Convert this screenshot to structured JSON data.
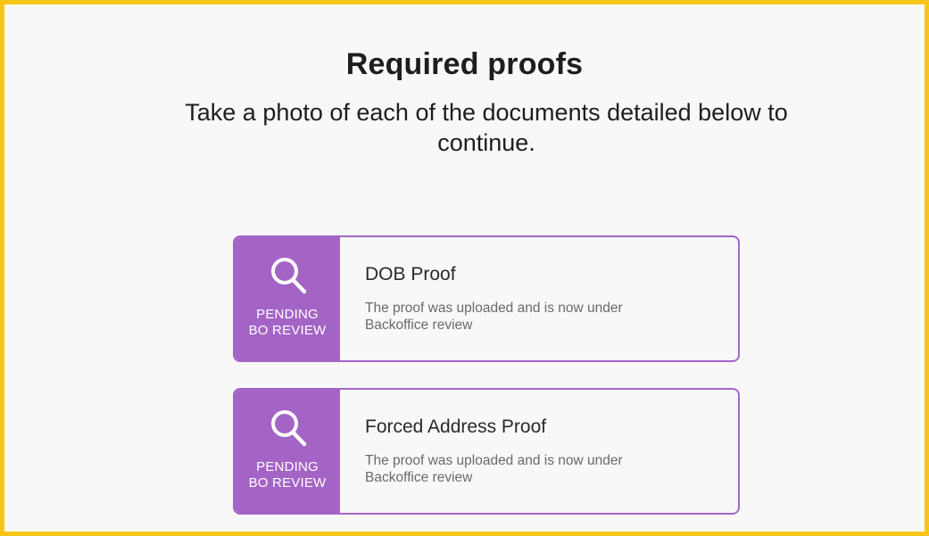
{
  "header": {
    "title": "Required proofs",
    "subtitle": "Take a photo of each of the documents detailed below to continue."
  },
  "proofs": [
    {
      "name": "DOB Proof",
      "status_line1": "PENDING",
      "status_line2": "BO REVIEW",
      "status_icon": "search-icon",
      "description": "The proof was uploaded and is now under Backoffice review"
    },
    {
      "name": "Forced Address Proof",
      "status_line1": "PENDING",
      "status_line2": "BO REVIEW",
      "status_icon": "search-icon",
      "description": "The proof was uploaded and is now under Backoffice review"
    }
  ],
  "colors": {
    "accent": "#a464c6",
    "frame_border": "#f5c518",
    "background": "#f8f8f8"
  }
}
